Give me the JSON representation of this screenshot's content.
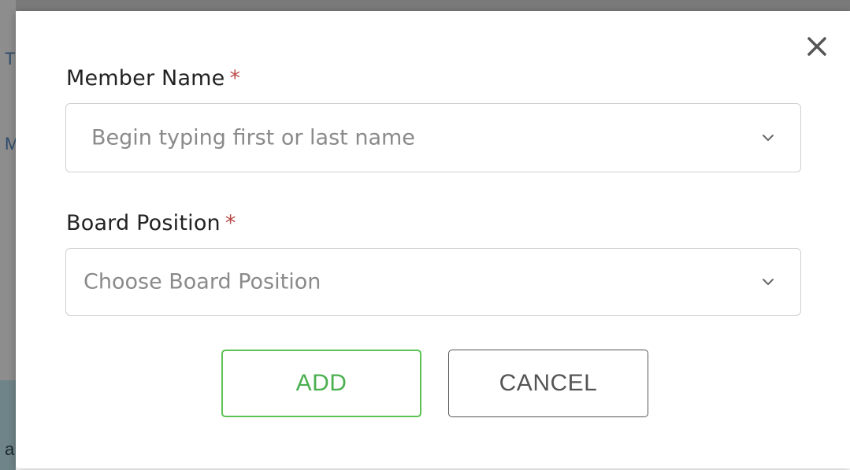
{
  "background": {
    "fragments": [
      "T",
      "M",
      "a"
    ]
  },
  "modal": {
    "close_icon": "close-icon",
    "member_field": {
      "label": "Member Name",
      "required_marker": "*",
      "placeholder": "Begin typing first or last name",
      "icon": "chevron-down-icon"
    },
    "board_field": {
      "label": "Board Position",
      "required_marker": "*",
      "placeholder": "Choose Board Position",
      "icon": "chevron-down-icon"
    },
    "actions": {
      "add_label": "ADD",
      "cancel_label": "CANCEL"
    }
  },
  "colors": {
    "required": "#b94a48",
    "add_accent": "#4caf50",
    "cancel": "#555555",
    "placeholder": "#8a8a8a"
  }
}
